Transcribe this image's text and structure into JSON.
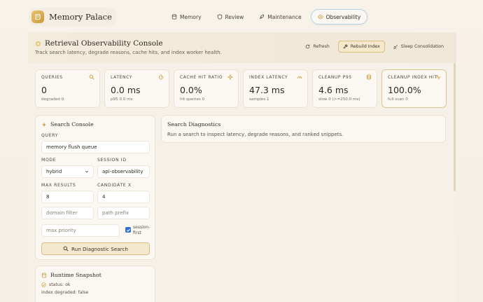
{
  "app": {
    "name": "Memory Palace"
  },
  "nav": [
    {
      "label": "Memory",
      "icon": "database-icon",
      "active": false
    },
    {
      "label": "Review",
      "icon": "shield-icon",
      "active": false
    },
    {
      "label": "Maintenance",
      "icon": "feather-icon",
      "active": false
    },
    {
      "label": "Observability",
      "icon": "eye-icon",
      "active": true
    }
  ],
  "header": {
    "title": "Retrieval Observability Console",
    "subtitle": "Track search latency, degrade reasons, cache hits, and index worker health.",
    "actions": {
      "refresh": "Refresh",
      "rebuild": "Rebuild Index",
      "sleep": "Sleep Consolidation"
    }
  },
  "stats": [
    {
      "label": "QUERIES",
      "value": "0",
      "sub": "degraded 0",
      "icon": "search-icon"
    },
    {
      "label": "LATENCY",
      "value": "0.0 ms",
      "sub": "p95 0.0 ms",
      "icon": "timer-icon"
    },
    {
      "label": "CACHE HIT RATIO",
      "value": "0.0%",
      "sub": "hit queries 0",
      "icon": "sparkle-icon"
    },
    {
      "label": "INDEX LATENCY",
      "value": "47.3 ms",
      "sub": "samples 1",
      "icon": "gauge-icon"
    },
    {
      "label": "CLEANUP P95",
      "value": "4.6 ms",
      "sub": "slow 0 (>=250.0 ms)",
      "icon": "database-icon"
    },
    {
      "label": "CLEANUP INDEX HIT",
      "value": "100.0%",
      "sub": "full scan 0",
      "icon": "pulse-icon"
    }
  ],
  "search_console": {
    "title": "Search Console",
    "query_label": "QUERY",
    "query_value": "memory flush queue",
    "mode_label": "MODE",
    "mode_value": "hybrid",
    "session_label": "SESSION ID",
    "session_value": "api-observability",
    "max_label": "MAX RESULTS",
    "max_value": "8",
    "candidate_label": "CANDIDATE X",
    "candidate_value": "4",
    "domain_placeholder": "domain filter",
    "path_placeholder": "path prefix",
    "priority_placeholder": "max priority",
    "session_first_label": "session-first",
    "session_first_checked": true,
    "run_label": "Run Diagnostic Search"
  },
  "diagnostics": {
    "title": "Search Diagnostics",
    "empty_text": "Run a search to inspect latency, degrade reasons, and ranked snippets."
  },
  "runtime": {
    "title": "Runtime Snapshot",
    "status": "status: ok",
    "index_degraded": "index degraded: false"
  },
  "colors": {
    "accent": "#c99a36",
    "active_border": "#b8d0e6",
    "checkbox": "#2f6fd8"
  }
}
